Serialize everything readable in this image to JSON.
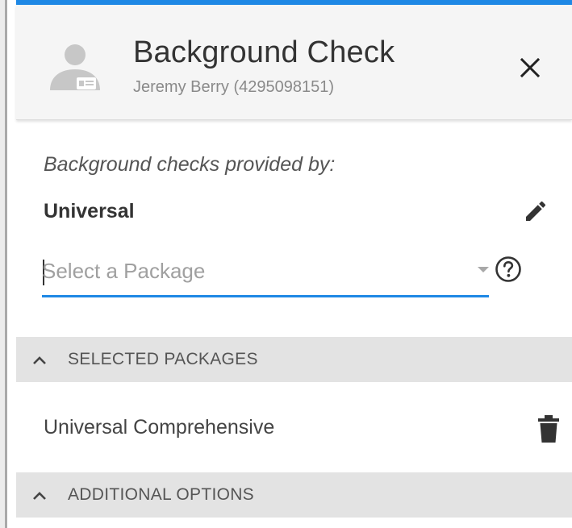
{
  "header": {
    "title": "Background Check",
    "subtitle": "Jeremy Berry (4295098151)",
    "avatar_icon": "person-id-card-icon",
    "close_icon": "close-icon"
  },
  "provider": {
    "label": "Background checks provided by:",
    "name": "Universal",
    "edit_icon": "pencil-icon"
  },
  "package_select": {
    "placeholder": "Select a Package",
    "arrow_icon": "dropdown-arrow-icon",
    "help_icon": "help-circle-icon"
  },
  "sections": {
    "selected_packages": {
      "label": "SELECTED PACKAGES",
      "icon": "chevron-up-icon",
      "items": [
        {
          "name": "Universal Comprehensive",
          "delete_icon": "trash-icon"
        }
      ]
    },
    "additional_options": {
      "label": "ADDITIONAL OPTIONS",
      "icon": "chevron-up-icon"
    }
  },
  "colors": {
    "accent": "#1e88e5",
    "header_bg": "#f5f5f5",
    "section_bg": "#e3e3e3",
    "icon": "#333333"
  }
}
